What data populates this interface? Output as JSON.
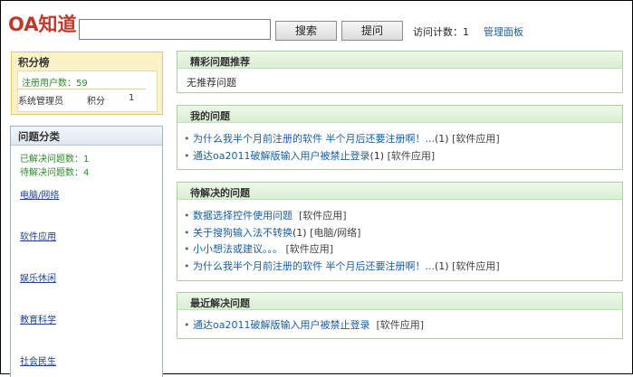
{
  "header": {
    "logo": "OA知道",
    "search_placeholder": "",
    "search_button": "搜索",
    "ask_button": "提问",
    "visit_count": "访问计数：1",
    "admin_link": "管理面板"
  },
  "score_board": {
    "title": "积分榜",
    "users_count": "注册用户数：59",
    "rows": [
      {
        "name": "系统管理员",
        "label": "积分",
        "value": "1"
      }
    ]
  },
  "categories": {
    "title": "问题分类",
    "solved": "已解决问题数：1",
    "pending": "待解决问题数：4",
    "items": [
      "电脑/网络",
      "软件应用",
      "娱乐休闲",
      "教育科学",
      "社会民生"
    ]
  },
  "featured": {
    "title": "精彩问题推荐",
    "empty_text": "无推荐问题"
  },
  "my_questions": {
    "title": "我的问题",
    "items": [
      {
        "title": "为什么我半个月前注册的软件 半个月后还要注册啊！...",
        "count": "(1)",
        "tag": "[软件应用]"
      },
      {
        "title": "通达oa2011破解版输入用户被禁止登录",
        "count": "(1)",
        "tag": "[软件应用]"
      }
    ]
  },
  "pending_questions": {
    "title": "待解决的问题",
    "items": [
      {
        "title": "数据选择控件使用问题",
        "count": "",
        "tag": "[软件应用]"
      },
      {
        "title": "关于搜狗输入法不转换",
        "count": "(1)",
        "tag": "[电脑/网络]"
      },
      {
        "title": "小小想法或建议。。。",
        "count": "",
        "tag": "[软件应用]"
      },
      {
        "title": "为什么我半个月前注册的软件 半个月后还要注册啊！...",
        "count": "(1)",
        "tag": "[软件应用]"
      }
    ]
  },
  "recent_solved": {
    "title": "最近解决问题",
    "items": [
      {
        "title": "通达oa2011破解版输入用户被禁止登录",
        "count": "",
        "tag": "[软件应用]"
      }
    ]
  },
  "colors": {
    "logo": "#c0392b",
    "link": "#1a5fa0",
    "green_text": "#2c8a2c",
    "box_border": "#a8d3a0"
  }
}
